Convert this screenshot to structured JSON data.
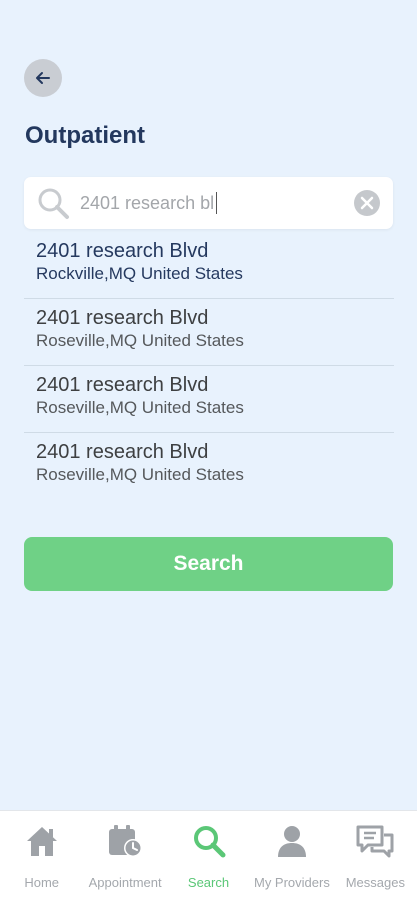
{
  "header": {
    "title": "Outpatient"
  },
  "search": {
    "query": "2401 research bl"
  },
  "results": [
    {
      "street": "2401 research Blvd",
      "city": "Rockville,MQ United States"
    },
    {
      "street": "2401 research Blvd",
      "city": "Roseville,MQ United States"
    },
    {
      "street": "2401 research Blvd",
      "city": "Roseville,MQ United States"
    },
    {
      "street": "2401 research Blvd",
      "city": "Roseville,MQ United States"
    }
  ],
  "actions": {
    "search_label": "Search"
  },
  "tabs": [
    {
      "label": "Home",
      "icon": "home-icon"
    },
    {
      "label": "Appointment",
      "icon": "calendar-clock-icon"
    },
    {
      "label": "Search",
      "icon": "search-icon",
      "active": true
    },
    {
      "label": "My Providers",
      "icon": "person-icon"
    },
    {
      "label": "Messages",
      "icon": "chat-bubbles-icon"
    }
  ],
  "colors": {
    "accent": "#6fd186",
    "title": "#23385e",
    "background": "#e8f2fd"
  }
}
